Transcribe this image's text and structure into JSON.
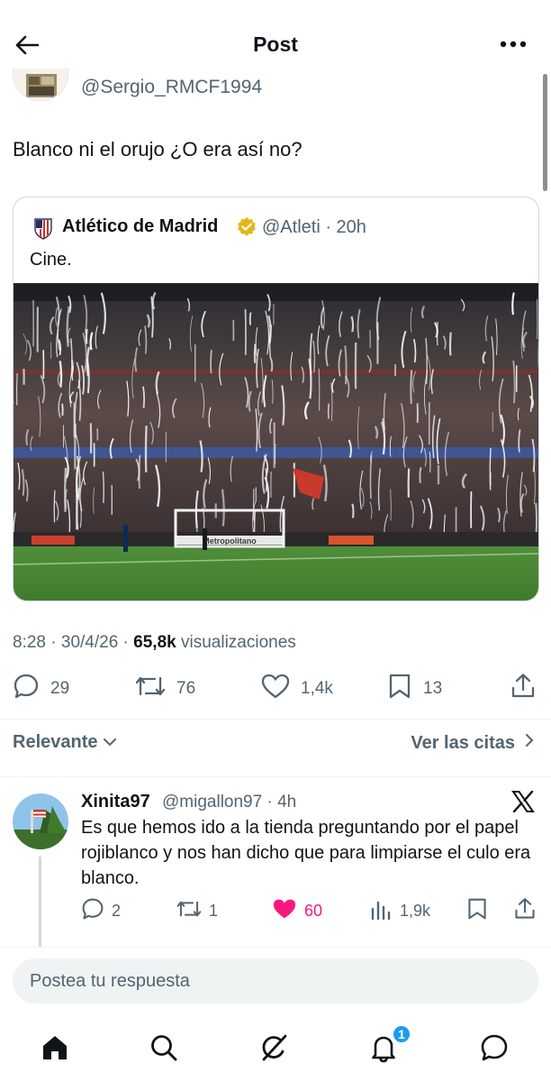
{
  "header": {
    "title": "Post"
  },
  "author": {
    "handle": "@Sergio_RMCF1994"
  },
  "post": {
    "text": "Blanco ni el orujo ¿O era así no?",
    "time": "8:28",
    "date": "30/4/26",
    "views_count": "65,8k",
    "views_label": "visualizaciones",
    "stats": {
      "replies": "29",
      "reposts": "76",
      "likes": "1,4k",
      "bookmarks": "13"
    }
  },
  "quote": {
    "name": "Atlético de Madrid",
    "handle": "@Atleti",
    "age": "20h",
    "text": "Cine.",
    "ad_board_text": "Metropolitano"
  },
  "filters": {
    "sort_label": "Relevante",
    "quotes_link": "Ver las citas"
  },
  "reply": {
    "name": "Xinita97",
    "handle": "@migallon97",
    "age": "4h",
    "text": "Es que hemos ido a la tienda preguntando por el papel rojiblanco y nos han dicho que para limpiarse el culo era blanco.",
    "stats": {
      "replies": "2",
      "reposts": "1",
      "likes": "60",
      "views": "1,9k"
    }
  },
  "compose": {
    "placeholder": "Postea tu respuesta"
  },
  "nav": {
    "notifications_badge": "1"
  },
  "colors": {
    "accent": "#1d9bf0",
    "like": "#f91880",
    "text": "#0f1419",
    "muted": "#536471",
    "verified_gold": "#e2b719"
  }
}
